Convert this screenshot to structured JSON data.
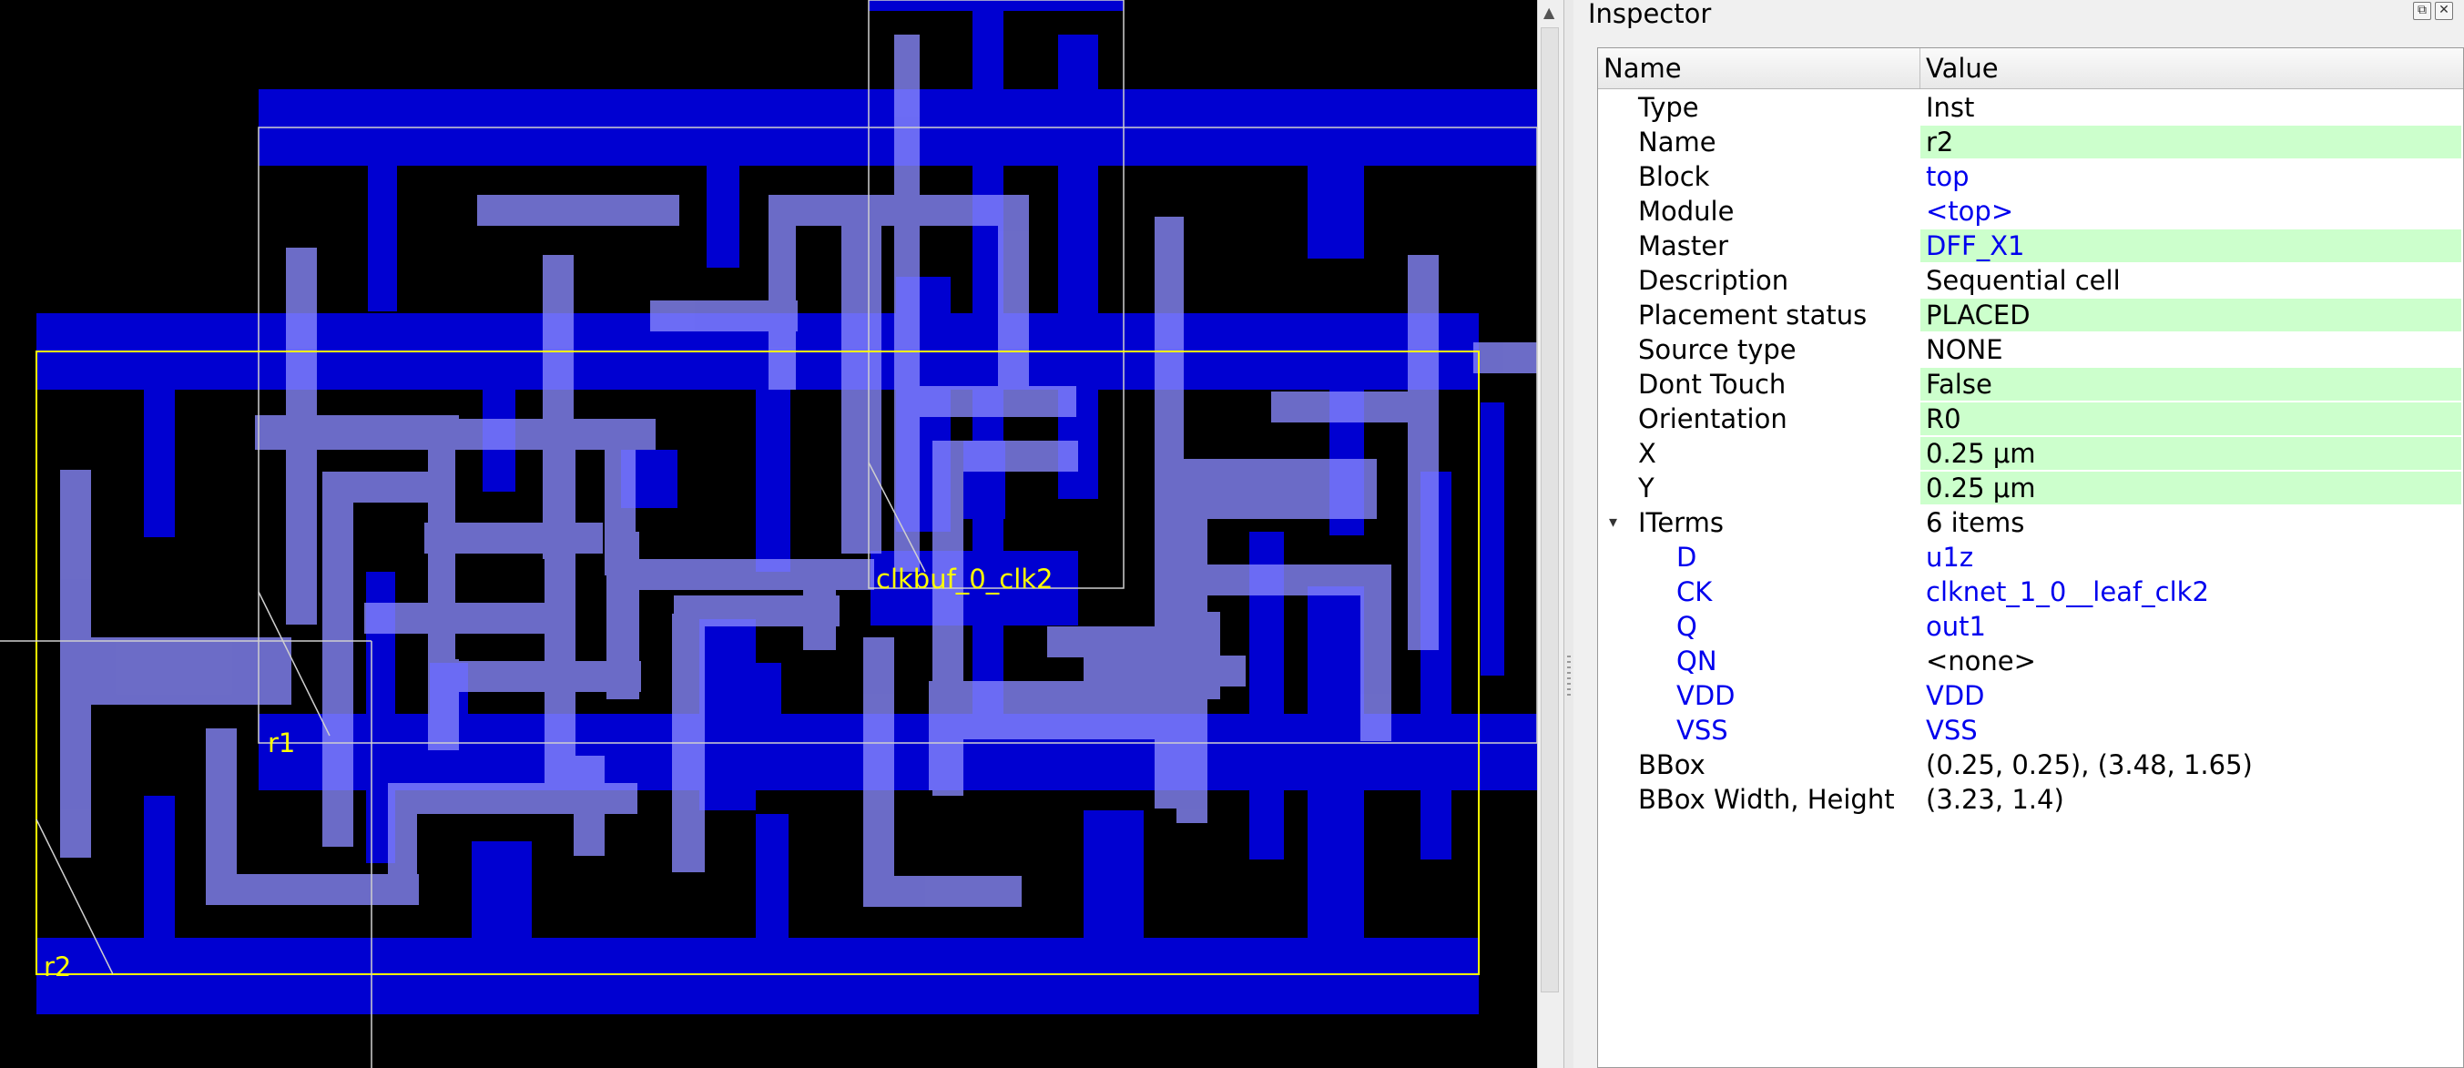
{
  "layout": {
    "labels": {
      "r1": "r1",
      "r2": "r2",
      "clkbuf": "clkbuf_0_clk2"
    },
    "colors": {
      "background": "#000000",
      "metal_dark": "#0000ff",
      "metal_light": "#8080ff",
      "highlight": "#ffff00"
    }
  },
  "inspector": {
    "title": "Inspector",
    "header": {
      "name": "Name",
      "value": "Value"
    },
    "rows": [
      {
        "name": "Type",
        "value": "Inst",
        "editable": false,
        "link": false
      },
      {
        "name": "Name",
        "value": "r2",
        "editable": true,
        "link": false
      },
      {
        "name": "Block",
        "value": "top",
        "editable": false,
        "link": true
      },
      {
        "name": "Module",
        "value": "<top>",
        "editable": false,
        "link": true
      },
      {
        "name": "Master",
        "value": "DFF_X1",
        "editable": true,
        "link": true
      },
      {
        "name": "Description",
        "value": "Sequential cell",
        "editable": false,
        "link": false
      },
      {
        "name": "Placement status",
        "value": "PLACED",
        "editable": true,
        "link": false
      },
      {
        "name": "Source type",
        "value": "NONE",
        "editable": false,
        "link": false
      },
      {
        "name": "Dont Touch",
        "value": "False",
        "editable": true,
        "link": false
      },
      {
        "name": "Orientation",
        "value": "R0",
        "editable": true,
        "link": false
      },
      {
        "name": "X",
        "value": "0.25 μm",
        "editable": true,
        "link": false
      },
      {
        "name": "Y",
        "value": "0.25 μm",
        "editable": true,
        "link": false
      },
      {
        "name": "ITerms",
        "value": "6 items",
        "editable": false,
        "link": false,
        "expander": "▾"
      },
      {
        "name": "D",
        "value": "u1z",
        "editable": false,
        "link": true,
        "child": true
      },
      {
        "name": "CK",
        "value": "clknet_1_0__leaf_clk2",
        "editable": false,
        "link": true,
        "child": true
      },
      {
        "name": "Q",
        "value": "out1",
        "editable": false,
        "link": true,
        "child": true
      },
      {
        "name": "QN",
        "value": "<none>",
        "editable": false,
        "link": false,
        "child": true
      },
      {
        "name": "VDD",
        "value": "VDD",
        "editable": false,
        "link": true,
        "child": true
      },
      {
        "name": "VSS",
        "value": "VSS",
        "editable": false,
        "link": true,
        "child": true
      },
      {
        "name": "BBox",
        "value": "(0.25, 0.25), (3.48, 1.65)",
        "editable": false,
        "link": false
      },
      {
        "name": "BBox Width, Height",
        "value": "(3.23, 1.4)",
        "editable": false,
        "link": false
      }
    ]
  }
}
